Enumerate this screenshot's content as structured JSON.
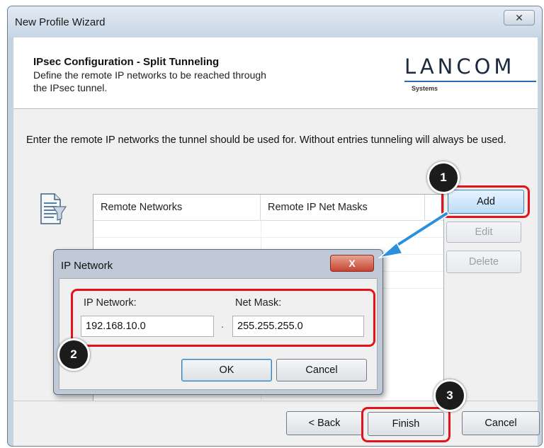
{
  "window": {
    "title": "New Profile Wizard",
    "close_glyph": "✕"
  },
  "header": {
    "title": "IPsec Configuration - Split Tunneling",
    "subtitle_line1": "Define the remote IP networks to be reached through",
    "subtitle_line2": "the IPsec tunnel.",
    "logo_text": "LANCOM",
    "logo_subtext": "Systems"
  },
  "content": {
    "instruction": "Enter the remote IP networks the tunnel should be used for. Without entries tunneling will always be used.",
    "icon": "network-list-document-icon",
    "table": {
      "columns": [
        "Remote Networks",
        "Remote IP Net Masks"
      ],
      "rows": []
    }
  },
  "side_buttons": {
    "add": "Add",
    "edit": "Edit",
    "delete": "Delete"
  },
  "footer": {
    "back": "< Back",
    "finish": "Finish",
    "cancel": "Cancel"
  },
  "dialog": {
    "title": "IP Network",
    "close_glyph": "X",
    "ip_label": "IP Network:",
    "ip_value": "192.168.10.0",
    "mask_label": "Net Mask:",
    "mask_value": "255.255.255.0",
    "separator": ".",
    "ok": "OK",
    "cancel": "Cancel"
  },
  "callouts": {
    "step1": "1",
    "step2": "2",
    "step3": "3"
  },
  "colors": {
    "highlight": "#e5121a",
    "arrow": "#2a8fdc",
    "logo_accent": "#2f67b1"
  }
}
